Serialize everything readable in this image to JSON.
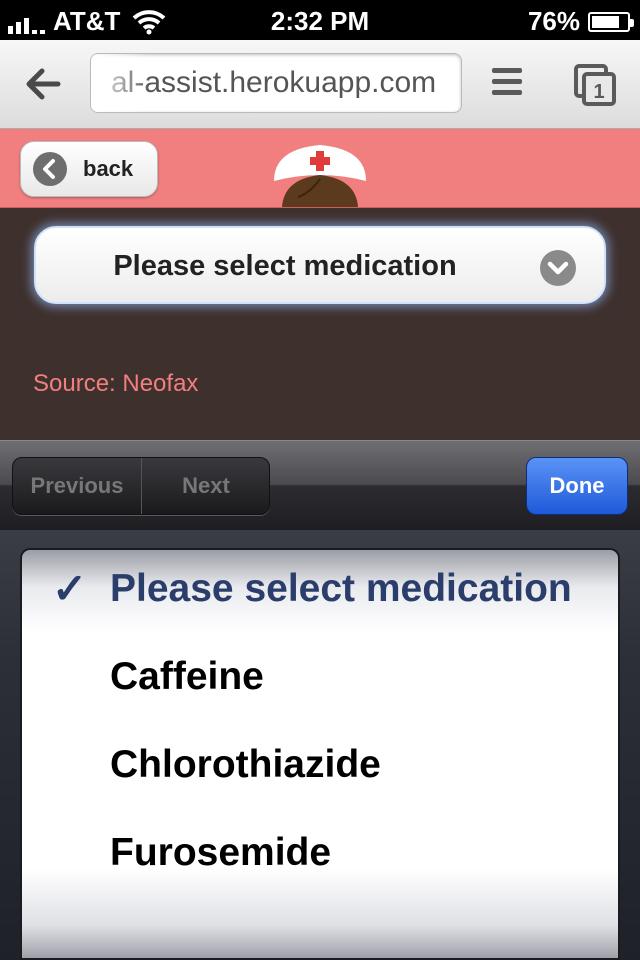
{
  "status_bar": {
    "carrier": "AT&T",
    "time": "2:32 PM",
    "battery": "76%",
    "battery_level": 0.76
  },
  "browser": {
    "url": "al-assist.herokuapp.com",
    "tab_count": "1"
  },
  "header": {
    "back_label": "back"
  },
  "main": {
    "select_value": "Please select medication",
    "source": "Source: Neofax"
  },
  "form_toolbar": {
    "previous_label": "Previous",
    "next_label": "Next",
    "done_label": "Done"
  },
  "picker": {
    "checkmark": "✓",
    "options": [
      {
        "label": "Please select medication",
        "selected": true
      },
      {
        "label": "Caffeine",
        "selected": false
      },
      {
        "label": "Chlorothiazide",
        "selected": false
      },
      {
        "label": "Furosemide",
        "selected": false
      }
    ]
  },
  "colors": {
    "header_bg": "#f27f7f",
    "content_bg": "#3e302d",
    "source_text": "#f27f7f",
    "done_button": "#2563dd",
    "selected_option": "#2b3e6b"
  },
  "icons": [
    "signal-icon",
    "wifi-icon",
    "battery-icon",
    "back-arrow-icon",
    "menu-icon",
    "tabs-icon",
    "back-circle-icon",
    "nurse-cap-logo",
    "chevron-down-icon",
    "checkmark-icon"
  ]
}
